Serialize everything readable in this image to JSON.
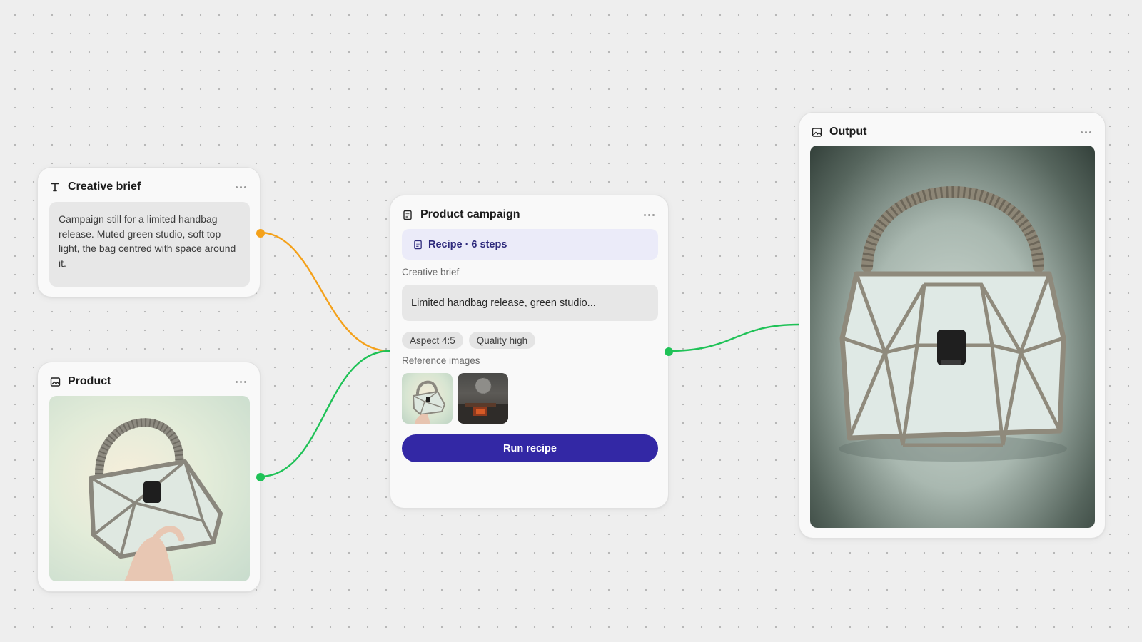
{
  "colors": {
    "brief_wire": "#f4a11a",
    "image_wire": "#1fc257",
    "primary_button": "#3328a5",
    "recipe_accent": "#2e2a7c"
  },
  "creative_brief_node": {
    "icon": "text-icon",
    "title": "Creative brief",
    "more_icon": "more-horizontal-icon",
    "text": "Campaign still for a limited handbag release. Muted green studio, soft top light, the bag centred with space around it."
  },
  "product_node": {
    "icon": "image-icon",
    "title": "Product",
    "more_icon": "more-horizontal-icon"
  },
  "campaign_node": {
    "icon": "document-icon",
    "title": "Product campaign",
    "more_icon": "more-horizontal-icon",
    "recipe_icon": "document-icon",
    "recipe_label": "Recipe · 6 steps",
    "brief_label": "Creative brief",
    "brief_value": "Limited handbag release, green studio...",
    "chips": [
      "Aspect 4:5",
      "Quality high"
    ],
    "reference_label": "Reference images",
    "run_button": "Run recipe"
  },
  "output_node": {
    "icon": "image-icon",
    "title": "Output",
    "more_icon": "more-horizontal-icon"
  }
}
